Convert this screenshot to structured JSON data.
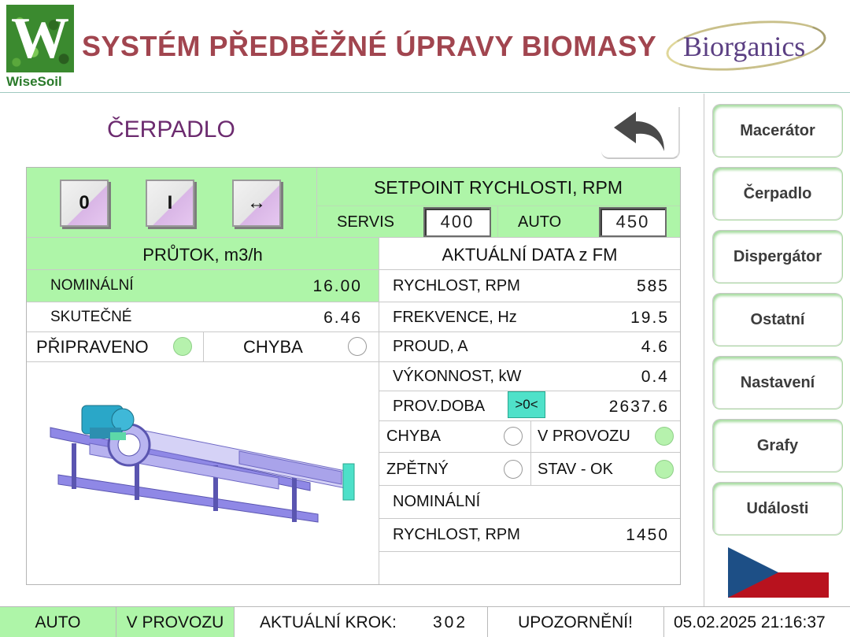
{
  "header": {
    "logo_text": "WiseSoil",
    "logo_letter": "W",
    "title": "SYSTÉM PŘEDBĚŽNÉ ÚPRAVY BIOMASY",
    "brand": "Biorganics"
  },
  "page": {
    "heading": "ČERPADLO"
  },
  "commands": {
    "off_label": "0",
    "on_label": "I",
    "reverse_label": "↔"
  },
  "setpoint": {
    "title": "SETPOINT RYCHLOSTI, RPM",
    "servis_label": "SERVIS",
    "servis_value": "400",
    "auto_label": "AUTO",
    "auto_value": "450"
  },
  "flow": {
    "title": "PRŮTOK, m3/h",
    "nominal_label": "NOMINÁLNÍ",
    "nominal_value": "16.00",
    "actual_label": "SKUTEČNÉ",
    "actual_value": "6.46",
    "ready_label": "PŘIPRAVENO",
    "ready_on": true,
    "error_label": "CHYBA",
    "error_on": false
  },
  "fm_data": {
    "title": "AKTUÁLNÍ DATA z FM",
    "rows": [
      {
        "label": "RYCHLOST, RPM",
        "value": "585"
      },
      {
        "label": "FREKVENCE, Hz",
        "value": "19.5"
      },
      {
        "label": "PROUD, A",
        "value": "4.6"
      },
      {
        "label": "VÝKONNOST, kW",
        "value": "0.4"
      },
      {
        "label": "PROV.DOBA",
        "value": "2637.6"
      }
    ],
    "reset_label": ">0<",
    "chyba_label": "CHYBA",
    "chyba_on": false,
    "provoz_label": "V PROVOZU",
    "provoz_on": true,
    "zpetny_label": "ZPĚTNÝ",
    "zpetny_on": false,
    "stav_label": "STAV - OK",
    "stav_on": true,
    "nominal_header": "NOMINÁLNÍ",
    "nominal_speed_label": "RYCHLOST, RPM",
    "nominal_speed_value": "1450"
  },
  "nav": {
    "items": [
      {
        "label": "Macerátor"
      },
      {
        "label": "Čerpadlo"
      },
      {
        "label": "Dispergátor"
      },
      {
        "label": "Ostatní"
      },
      {
        "label": "Nastavení"
      },
      {
        "label": "Grafy"
      },
      {
        "label": "Události"
      }
    ]
  },
  "status": {
    "mode": "AUTO",
    "state": "V PROVOZU",
    "step_label": "AKTUÁLNÍ KROK:",
    "step_value": "302",
    "warning": "UPOZORNĚNÍ!",
    "datetime": "05.02.2025 21:16:37"
  },
  "colors": {
    "accent_green": "#aef5a8",
    "title_red": "#a1454f",
    "heading_purple": "#6c2b6f",
    "brand_purple": "#5b3f83",
    "led_on": "#b6f2ad",
    "reset_cyan": "#4fe1c9"
  },
  "icons": {
    "back": "back-arrow-icon",
    "flag": "czech-flag-icon",
    "pump": "pump-illustration"
  }
}
